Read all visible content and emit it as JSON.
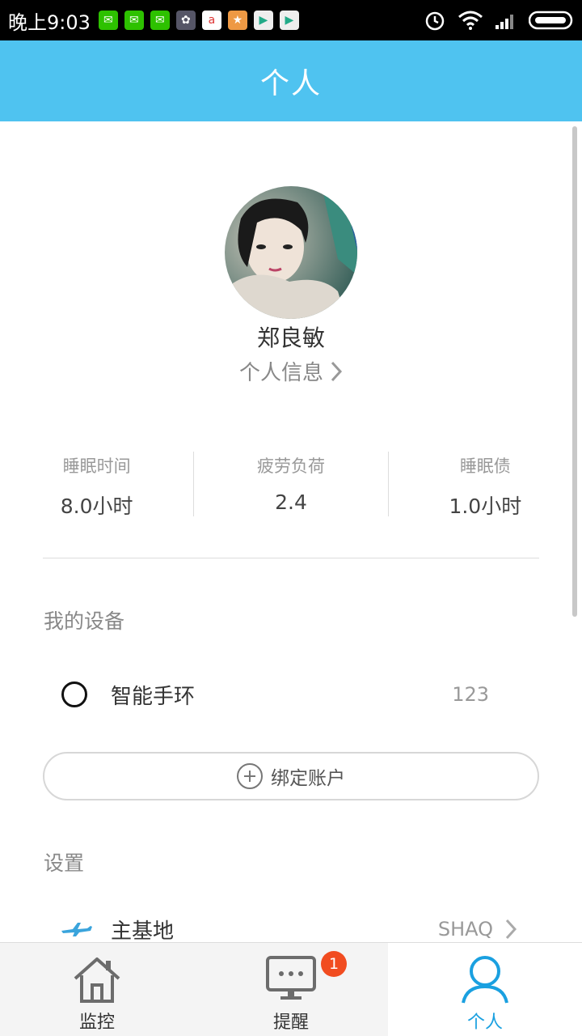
{
  "status_bar": {
    "time": "晚上9:03",
    "battery_icon": "battery-icon",
    "signal_icon": "signal-icon",
    "wifi_icon": "wifi-icon",
    "alarm_icon": "alarm-icon"
  },
  "header": {
    "title": "个人"
  },
  "profile": {
    "name": "郑良敏",
    "link_label": "个人信息"
  },
  "stats": [
    {
      "label": "睡眠时间",
      "value": "8.0小时"
    },
    {
      "label": "疲劳负荷",
      "value": "2.4"
    },
    {
      "label": "睡眠债",
      "value": "1.0小时"
    }
  ],
  "devices": {
    "title": "我的设备",
    "items": [
      {
        "name": "智能手环",
        "value": "123"
      }
    ],
    "bind_label": "绑定账户"
  },
  "settings": {
    "title": "设置",
    "home_label": "主基地",
    "home_value": "SHAQ"
  },
  "tabs": [
    {
      "label": "监控"
    },
    {
      "label": "提醒",
      "badge": "1"
    },
    {
      "label": "个人"
    }
  ],
  "colors": {
    "accent": "#4fc3f0",
    "active_tab": "#1aa0e0",
    "badge": "#f14c20"
  }
}
